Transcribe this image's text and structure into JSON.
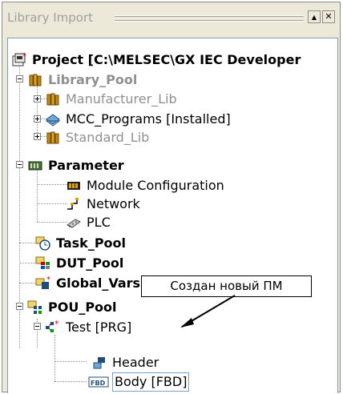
{
  "panel": {
    "title": "Library Import",
    "minimize_glyph": "▲",
    "close_glyph": "✕"
  },
  "tree": {
    "project": "Project [C:\\MELSEC\\GX IEC Developer ",
    "library_pool": "Library_Pool",
    "manufacturer_lib": "Manufacturer_Lib",
    "mcc_programs": "MCC_Programs [Installed]",
    "standard_lib": "Standard_Lib",
    "parameter": "Parameter",
    "module_config": "Module Configuration",
    "network": "Network",
    "plc": "PLC",
    "task_pool": "Task_Pool",
    "dut_pool": "DUT_Pool",
    "global_vars": "Global_Vars",
    "pou_pool": "POU_Pool",
    "test_prg": "Test [PRG]",
    "header": "Header",
    "body_fbd": "Body [FBD]",
    "fbd_badge": "FBD"
  },
  "callout": {
    "text": "Создан новый ПМ"
  },
  "colors": {
    "panel_bg": "#ece9d8",
    "selection": "#7aa0d0",
    "disabled_text": "#909090"
  }
}
